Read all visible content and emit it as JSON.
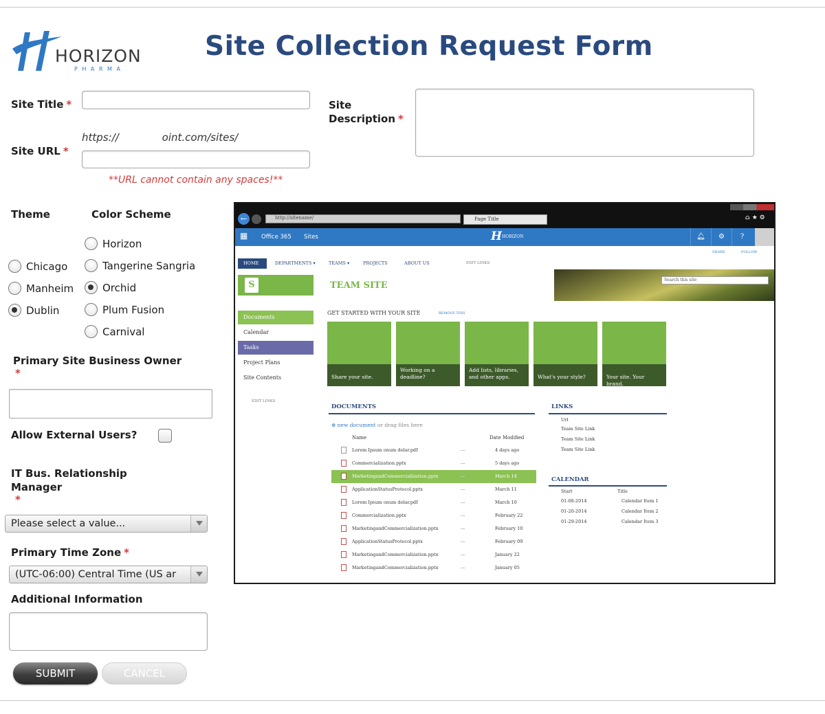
{
  "logo": {
    "brand": "HORIZON",
    "sub": "P H A R M A"
  },
  "page_title": "Site Collection Request Form",
  "form": {
    "site_title_label": "Site Title",
    "site_description_label_1": "Site",
    "site_description_label_2": "Description",
    "site_url_label": "Site URL",
    "site_url_prefix": "https://                     oint.com/sites/",
    "url_note": "**URL cannot contain any spaces!**",
    "required_mark": "*",
    "theme_label": "Theme",
    "color_scheme_label": "Color Scheme",
    "themes": [
      {
        "label": "Chicago",
        "checked": false
      },
      {
        "label": "Manheim",
        "checked": false
      },
      {
        "label": "Dublin",
        "checked": true
      }
    ],
    "color_schemes": [
      {
        "label": "Horizon",
        "checked": false
      },
      {
        "label": "Tangerine Sangria",
        "checked": false
      },
      {
        "label": "Orchid",
        "checked": true
      },
      {
        "label": "Plum Fusion",
        "checked": false
      },
      {
        "label": "Carnival",
        "checked": false
      }
    ],
    "owner_label": "Primary Site Business Owner",
    "external_label": "Allow External Users?",
    "it_label_1": "IT Bus. Relationship",
    "it_label_2": "Manager",
    "it_select_value": "Please select a value...",
    "timezone_label": "Primary Time Zone",
    "timezone_value": "(UTC-06:00) Central Time (US ar",
    "additional_label": "Additional Information",
    "submit_label": "SUBMIT",
    "cancel_label": "CANCEL"
  },
  "preview": {
    "address": "http://sitename/",
    "tab_title": "Page Title",
    "suite_office": "Office 365",
    "suite_sites": "Sites",
    "brand": "HORIZON",
    "share": "SHARE",
    "follow": "FOLLOW",
    "topnav": [
      "HOME",
      "DEPARTMENTS ▾",
      "TEAMS ▾",
      "PROJECTS",
      "ABOUT US"
    ],
    "edit_links": "EDIT LINKS",
    "site_title": "TEAM SITE",
    "search_placeholder": "Search this site",
    "leftnav": [
      "Documents",
      "Calendar",
      "Tasks",
      "Project Plans",
      "Site Contents"
    ],
    "get_started": "GET STARTED WITH YOUR SITE",
    "remove_this": "REMOVE THIS",
    "tiles": [
      "Share your site.",
      "Working on a deadline?",
      "Add lists, libraries, and other apps.",
      "What's your style?",
      "Your site. Your brand."
    ],
    "documents_heading": "DOCUMENTS",
    "new_doc": "new document",
    "drag_files": " or drag files here",
    "col_name": "Name",
    "col_modified": "Date Modified",
    "docs": [
      {
        "name": "Lorem Ipsum onum dolar.pdf",
        "date": "4 days ago"
      },
      {
        "name": "Commercialization.pptx",
        "date": "5 days ago"
      },
      {
        "name": "MarketingandCommercialization.pptx",
        "date": "March 14"
      },
      {
        "name": "ApplicationStatusProtocol.pptx",
        "date": "March 11"
      },
      {
        "name": "Lorem Ipsum onum dolar.pdf",
        "date": "March 10"
      },
      {
        "name": "Commercialization.pptx",
        "date": "February 22"
      },
      {
        "name": "MarketingandCommercialization.pptx",
        "date": "February 10"
      },
      {
        "name": "ApplicationStatusProtocol.pptx",
        "date": "February 09"
      },
      {
        "name": "MarketingandCommercialization.pptx",
        "date": "January 22"
      },
      {
        "name": "MarketingandCommercialization.pptx",
        "date": "January 05"
      }
    ],
    "ellipsis": "...",
    "links_heading": "LINKS",
    "links_col": "Url",
    "links": [
      "Team Site Link",
      "Team Site Link",
      "Team Site Link"
    ],
    "calendar_heading": "CALENDAR",
    "cal_start": "Start",
    "cal_title": "Title",
    "calendar": [
      {
        "date": "01-08-2014",
        "title": "Calendar Item 1"
      },
      {
        "date": "01-20-2014",
        "title": "Calendar Item 2"
      },
      {
        "date": "01-29-2014",
        "title": "Calendar Item 3"
      }
    ]
  },
  "colors": {
    "title": "#2a4a7f",
    "required": "#d23a3a",
    "brand_blue": "#2f78c4",
    "green": "#7ab648"
  }
}
